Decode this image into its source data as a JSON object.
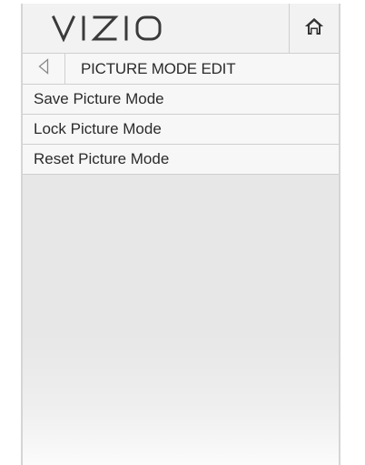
{
  "header": {
    "brand": "VIZIO",
    "home_icon": "home-icon"
  },
  "subheader": {
    "back_icon": "back-triangle-icon",
    "title": "PICTURE MODE EDIT"
  },
  "menu": {
    "items": [
      {
        "label": "Save Picture Mode"
      },
      {
        "label": "Lock Picture Mode"
      },
      {
        "label": "Reset Picture Mode"
      }
    ]
  },
  "colors": {
    "panel_bg": "#e7e7e7",
    "row_bg": "#f7f7f7",
    "header_bg": "#f2f2f2",
    "divider": "#cfcfcf",
    "text": "#2b2b2b",
    "logo": "#3a3a3a"
  }
}
